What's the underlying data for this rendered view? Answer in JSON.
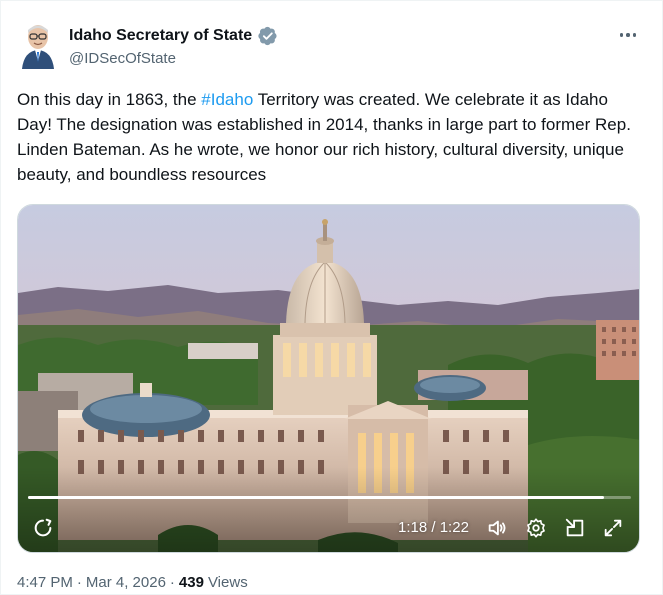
{
  "author": {
    "name": "Idaho Secretary of State",
    "handle": "@IDSecOfState",
    "verified_icon": "verified-badge-icon",
    "badge_color": "#829aab"
  },
  "tweet": {
    "text_before": "On this day in 1863, the ",
    "hashtag": "#Idaho",
    "text_after": " Territory was created. We celebrate it as Idaho Day! The designation was established in 2014, thanks in large part to former Rep. Linden Bateman. As he wrote, we honor our rich history, cultural diversity, unique beauty, and boundless resources"
  },
  "video": {
    "elapsed": "1:18",
    "separator": "/",
    "duration": "1:22",
    "progress_fraction": 0.955,
    "controls": [
      "replay-icon",
      "volume-icon",
      "settings-icon",
      "picture-in-picture-icon",
      "fullscreen-icon"
    ]
  },
  "meta": {
    "time": "4:47 PM",
    "dot": "·",
    "date": "Mar 4, 2026",
    "views_count": "439",
    "views_label": "Views"
  },
  "colors": {
    "link": "#1d9bf0",
    "secondary_text": "#536471",
    "primary_text": "#0f1419"
  }
}
